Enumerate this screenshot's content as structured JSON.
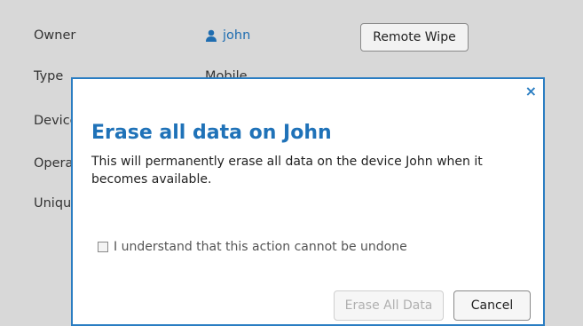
{
  "details": {
    "owner_label": "Owner",
    "owner_value": "john",
    "type_label": "Type",
    "type_value": "Mobile",
    "device_label": "Device",
    "operating_label": "Operating",
    "unique_label": "Unique",
    "remote_wipe_label": "Remote Wipe",
    "icons": {
      "owner": "user-icon"
    }
  },
  "dialog": {
    "close_glyph": "×",
    "title": "Erase all data on John",
    "message": "This will permanently erase all data on the device John when it becomes available.",
    "confirm_label": "I understand that this action cannot be undone",
    "confirm_checked": false,
    "erase_label": "Erase All Data",
    "cancel_label": "Cancel",
    "accent_color": "#2a7dc2"
  }
}
